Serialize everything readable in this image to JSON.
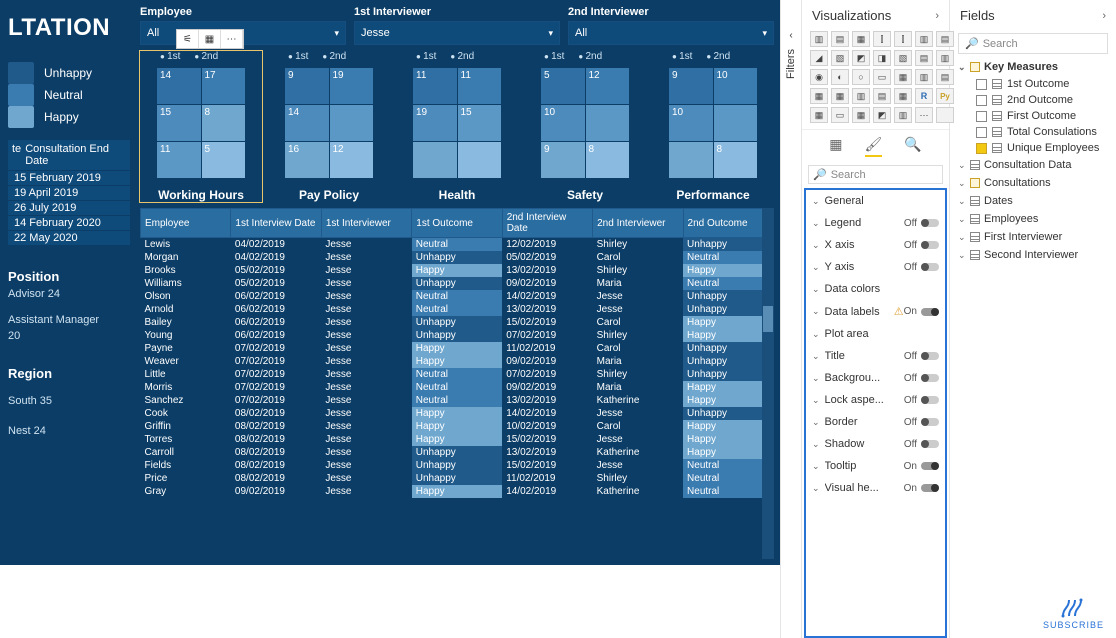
{
  "title": "LTATION",
  "legend": {
    "unhappy": "Unhappy",
    "neutral": "Neutral",
    "happy": "Happy"
  },
  "leftHeader": {
    "col1": "te",
    "col2": "Consultation End Date"
  },
  "dates": [
    "15 February 2019",
    "19 April 2019",
    "26 July 2019",
    "14 February 2020",
    "22 May 2020"
  ],
  "position": {
    "label": "Position",
    "value1": "Advisor 24",
    "value2": "Assistant Manager",
    "value3": "20"
  },
  "region": {
    "label": "Region",
    "value1": "South 35",
    "value2": "Nest 24"
  },
  "slicers": {
    "employee": {
      "label": "Employee",
      "value": "All"
    },
    "int1": {
      "label": "1st Interviewer",
      "value": "Jesse"
    },
    "int2": {
      "label": "2nd Interviewer",
      "value": "All"
    }
  },
  "tmAxis": {
    "a": "1st",
    "b": "2nd"
  },
  "treemaps": [
    {
      "caption": "Working Hours",
      "cells": [
        [
          14,
          "#2f6fa3"
        ],
        [
          17,
          "#3a7bb0"
        ],
        [
          15,
          "#4e8bbd"
        ],
        [
          8,
          "#6fa7cf"
        ],
        [
          11,
          "#5b98c6"
        ],
        [
          5,
          "#8abae0"
        ]
      ]
    },
    {
      "caption": "Pay Policy",
      "cells": [
        [
          9,
          "#2f6fa3"
        ],
        [
          19,
          "#3a7bb0"
        ],
        [
          14,
          "#4e8bbd"
        ],
        [
          "",
          "#5b98c6"
        ],
        [
          16,
          "#6fa7cf"
        ],
        [
          12,
          "#8abae0"
        ]
      ]
    },
    {
      "caption": "Health",
      "cells": [
        [
          11,
          "#2f6fa3"
        ],
        [
          11,
          "#3a7bb0"
        ],
        [
          19,
          "#4e8bbd"
        ],
        [
          15,
          "#5b98c6"
        ],
        [
          "",
          "#6fa7cf"
        ],
        [
          "",
          "#8abae0"
        ]
      ]
    },
    {
      "caption": "Safety",
      "cells": [
        [
          5,
          "#2f6fa3"
        ],
        [
          12,
          "#3a7bb0"
        ],
        [
          10,
          "#4e8bbd"
        ],
        [
          "",
          "#5b98c6"
        ],
        [
          9,
          "#6fa7cf"
        ],
        [
          8,
          "#8abae0"
        ]
      ]
    },
    {
      "caption": "Performance",
      "cells": [
        [
          9,
          "#2f6fa3"
        ],
        [
          10,
          "#3a7bb0"
        ],
        [
          10,
          "#4e8bbd"
        ],
        [
          "",
          "#5b98c6"
        ],
        [
          "",
          "#6fa7cf"
        ],
        [
          8,
          "#8abae0"
        ]
      ]
    }
  ],
  "tableHeaders": [
    "Employee",
    "1st Interview Date",
    "1st Interviewer",
    "1st Outcome",
    "2nd Interview Date",
    "2nd Interviewer",
    "2nd Outcome"
  ],
  "tableRows": [
    [
      "Lewis",
      "04/02/2019",
      "Jesse",
      "Neutral",
      "12/02/2019",
      "Shirley",
      "Unhappy"
    ],
    [
      "Morgan",
      "04/02/2019",
      "Jesse",
      "Unhappy",
      "05/02/2019",
      "Carol",
      "Neutral"
    ],
    [
      "Brooks",
      "05/02/2019",
      "Jesse",
      "Happy",
      "13/02/2019",
      "Shirley",
      "Happy"
    ],
    [
      "Williams",
      "05/02/2019",
      "Jesse",
      "Unhappy",
      "09/02/2019",
      "Maria",
      "Neutral"
    ],
    [
      "Olson",
      "06/02/2019",
      "Jesse",
      "Neutral",
      "14/02/2019",
      "Jesse",
      "Unhappy"
    ],
    [
      "Arnold",
      "06/02/2019",
      "Jesse",
      "Neutral",
      "13/02/2019",
      "Jesse",
      "Unhappy"
    ],
    [
      "Bailey",
      "06/02/2019",
      "Jesse",
      "Unhappy",
      "15/02/2019",
      "Carol",
      "Happy"
    ],
    [
      "Young",
      "06/02/2019",
      "Jesse",
      "Unhappy",
      "07/02/2019",
      "Shirley",
      "Happy"
    ],
    [
      "Payne",
      "07/02/2019",
      "Jesse",
      "Happy",
      "11/02/2019",
      "Carol",
      "Unhappy"
    ],
    [
      "Weaver",
      "07/02/2019",
      "Jesse",
      "Happy",
      "09/02/2019",
      "Maria",
      "Unhappy"
    ],
    [
      "Little",
      "07/02/2019",
      "Jesse",
      "Neutral",
      "07/02/2019",
      "Shirley",
      "Unhappy"
    ],
    [
      "Morris",
      "07/02/2019",
      "Jesse",
      "Neutral",
      "09/02/2019",
      "Maria",
      "Happy"
    ],
    [
      "Sanchez",
      "07/02/2019",
      "Jesse",
      "Neutral",
      "13/02/2019",
      "Katherine",
      "Happy"
    ],
    [
      "Cook",
      "08/02/2019",
      "Jesse",
      "Happy",
      "14/02/2019",
      "Jesse",
      "Unhappy"
    ],
    [
      "Griffin",
      "08/02/2019",
      "Jesse",
      "Happy",
      "10/02/2019",
      "Carol",
      "Happy"
    ],
    [
      "Torres",
      "08/02/2019",
      "Jesse",
      "Happy",
      "15/02/2019",
      "Jesse",
      "Happy"
    ],
    [
      "Carroll",
      "08/02/2019",
      "Jesse",
      "Unhappy",
      "13/02/2019",
      "Katherine",
      "Happy"
    ],
    [
      "Fields",
      "08/02/2019",
      "Jesse",
      "Unhappy",
      "15/02/2019",
      "Jesse",
      "Neutral"
    ],
    [
      "Price",
      "08/02/2019",
      "Jesse",
      "Unhappy",
      "11/02/2019",
      "Shirley",
      "Neutral"
    ],
    [
      "Gray",
      "09/02/2019",
      "Jesse",
      "Happy",
      "14/02/2019",
      "Katherine",
      "Neutral"
    ]
  ],
  "vizPane": {
    "title": "Visualizations",
    "searchPlaceholder": "Search",
    "format": [
      {
        "label": "General"
      },
      {
        "label": "Legend",
        "state": "Off"
      },
      {
        "label": "X axis",
        "state": "Off"
      },
      {
        "label": "Y axis",
        "state": "Off"
      },
      {
        "label": "Data colors"
      },
      {
        "label": "Data labels",
        "warn": true,
        "state": "On"
      },
      {
        "label": "Plot area"
      },
      {
        "label": "Title",
        "state": "Off"
      },
      {
        "label": "Backgrou...",
        "state": "Off"
      },
      {
        "label": "Lock aspe...",
        "state": "Off"
      },
      {
        "label": "Border",
        "state": "Off"
      },
      {
        "label": "Shadow",
        "state": "Off"
      },
      {
        "label": "Tooltip",
        "state": "On"
      },
      {
        "label": "Visual he...",
        "state": "On"
      }
    ]
  },
  "fieldsPane": {
    "title": "Fields",
    "searchPlaceholder": "Search",
    "groups": [
      {
        "name": "Key Measures",
        "open": true,
        "icon": "calc",
        "items": [
          {
            "name": "1st Outcome",
            "checked": false,
            "icon": "tbl"
          },
          {
            "name": "2nd Outcome",
            "checked": false,
            "icon": "tbl"
          },
          {
            "name": "First Outcome",
            "checked": false,
            "icon": "tbl"
          },
          {
            "name": "Total Consulations",
            "checked": false,
            "icon": "tbl"
          },
          {
            "name": "Unique Employees",
            "checked": true,
            "icon": "tbl"
          }
        ]
      },
      {
        "name": "Consultation Data",
        "open": false,
        "icon": "tbl"
      },
      {
        "name": "Consultations",
        "open": false,
        "icon": "calc"
      },
      {
        "name": "Dates",
        "open": false,
        "icon": "tbl"
      },
      {
        "name": "Employees",
        "open": false,
        "icon": "tbl"
      },
      {
        "name": "First Interviewer",
        "open": false,
        "icon": "tbl"
      },
      {
        "name": "Second Interviewer",
        "open": false,
        "icon": "tbl"
      }
    ]
  },
  "filtersLabel": "Filters",
  "subscribe": "SUBSCRIBE",
  "chart_data": [
    {
      "type": "treemap",
      "title": "Working Hours",
      "series": [
        {
          "name": "1st",
          "values": [
            14,
            15,
            11
          ]
        },
        {
          "name": "2nd",
          "values": [
            17,
            8,
            5
          ]
        }
      ]
    },
    {
      "type": "treemap",
      "title": "Pay Policy",
      "series": [
        {
          "name": "1st",
          "values": [
            9,
            14,
            16
          ]
        },
        {
          "name": "2nd",
          "values": [
            19,
            12
          ]
        }
      ]
    },
    {
      "type": "treemap",
      "title": "Health",
      "series": [
        {
          "name": "1st",
          "values": [
            11,
            19
          ]
        },
        {
          "name": "2nd",
          "values": [
            11,
            15
          ]
        }
      ]
    },
    {
      "type": "treemap",
      "title": "Safety",
      "series": [
        {
          "name": "1st",
          "values": [
            5,
            10,
            9
          ]
        },
        {
          "name": "2nd",
          "values": [
            12,
            8
          ]
        }
      ]
    },
    {
      "type": "treemap",
      "title": "Performance",
      "series": [
        {
          "name": "1st",
          "values": [
            9,
            10
          ]
        },
        {
          "name": "2nd",
          "values": [
            10,
            8
          ]
        }
      ]
    }
  ]
}
